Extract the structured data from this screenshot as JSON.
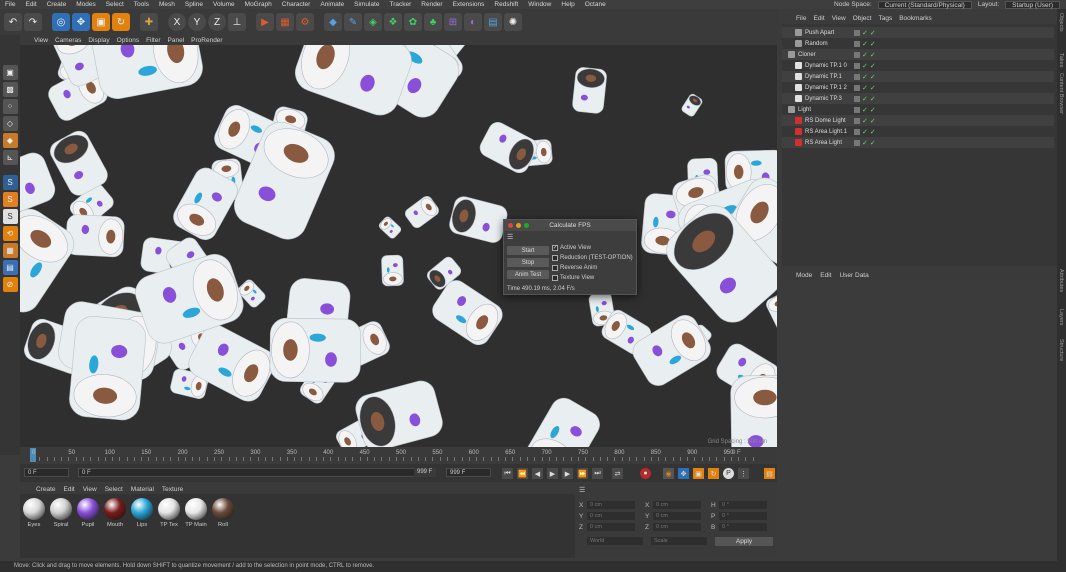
{
  "menubar": {
    "items": [
      "File",
      "Edit",
      "Create",
      "Modes",
      "Select",
      "Tools",
      "Mesh",
      "Spline",
      "Volume",
      "MoGraph",
      "Character",
      "Animate",
      "Simulate",
      "Tracker",
      "Render",
      "Extensions",
      "Redshift",
      "Window",
      "Help",
      "Octane"
    ],
    "node_space_label": "Node Space:",
    "node_space_value": "Current (Standard/Physical)",
    "layout_label": "Layout:",
    "layout_value": "Startup (User)"
  },
  "viewport": {
    "menu": [
      "View",
      "Cameras",
      "Display",
      "Options",
      "Filter",
      "Panel",
      "ProRender"
    ],
    "overlay": "Grid Spacing : 500 cm"
  },
  "fps_dialog": {
    "title": "Calculate FPS",
    "buttons": [
      "Start",
      "Stop",
      "Anim Test"
    ],
    "options": [
      {
        "label": "Active View",
        "checked": true
      },
      {
        "label": "Reduction (TEST-OPTION)",
        "checked": false
      },
      {
        "label": "Reverse Anim",
        "checked": false
      },
      {
        "label": "Texture View",
        "checked": false
      }
    ],
    "time": "Time 490.19 ms, 2.04 F/s"
  },
  "timeline": {
    "ticks": [
      "0",
      "50",
      "100",
      "150",
      "200",
      "250",
      "300",
      "350",
      "400",
      "450",
      "500",
      "550",
      "600",
      "650",
      "700",
      "750",
      "800",
      "850",
      "900",
      "950"
    ],
    "end_label": "0 F"
  },
  "transport": {
    "start_frame": "0 F",
    "current_frame": "0 F",
    "end_frame": "999 F",
    "max_frame": "999 F"
  },
  "material_manager": {
    "menu": [
      "Create",
      "Edit",
      "View",
      "Select",
      "Material",
      "Texture"
    ],
    "materials": [
      {
        "name": "Eyes",
        "color": "#d8d8d8"
      },
      {
        "name": "Spiral",
        "color": "#cfcfcf"
      },
      {
        "name": "Pupil",
        "color": "#8a4fd8"
      },
      {
        "name": "Mouth",
        "color": "#7a1a1a"
      },
      {
        "name": "Lips",
        "color": "#2aa6d8"
      },
      {
        "name": "TP Tex",
        "color": "#e4e4e4"
      },
      {
        "name": "TP Main",
        "color": "#e8e8e8"
      },
      {
        "name": "Roll",
        "color": "#6a4a3a"
      }
    ]
  },
  "coordinates": {
    "labels": [
      "X",
      "Y",
      "Z",
      "X",
      "Y",
      "Z",
      "H",
      "P",
      "B"
    ],
    "fields": [
      "0 cm",
      "0 cm",
      "0 cm",
      "0 cm",
      "0 cm",
      "0 cm",
      "0 °",
      "0 °",
      "0 °"
    ],
    "dropdown_1": "World",
    "dropdown_2": "Scale",
    "apply": "Apply"
  },
  "status": {
    "text": "Move: Click and drag to move elements. Hold down SHIFT to quantize movement / add to the selection in point mode, CTRL to remove."
  },
  "object_manager": {
    "menu": [
      "File",
      "Edit",
      "View",
      "Object",
      "Tags",
      "Bookmarks"
    ],
    "objects": [
      {
        "name": "Push Apart",
        "indent": 1,
        "icon_color": "#9a9a9a"
      },
      {
        "name": "Random",
        "indent": 1,
        "icon_color": "#9a9a9a"
      },
      {
        "name": "Cloner",
        "indent": 0,
        "icon_color": "#9a9a9a"
      },
      {
        "name": "Dynamic TP.1 0",
        "indent": 1,
        "icon_color": "#e0e0e0"
      },
      {
        "name": "Dynamic TP.1",
        "indent": 1,
        "icon_color": "#e0e0e0"
      },
      {
        "name": "Dynamic TP.1 2",
        "indent": 1,
        "icon_color": "#e0e0e0"
      },
      {
        "name": "Dynamic TP.3",
        "indent": 1,
        "icon_color": "#e0e0e0"
      },
      {
        "name": "Light",
        "indent": 0,
        "icon_color": "#9a9a9a"
      },
      {
        "name": "RS Dome Light",
        "indent": 1,
        "icon_color": "#d23030"
      },
      {
        "name": "RS Area Light.1",
        "indent": 1,
        "icon_color": "#d23030"
      },
      {
        "name": "RS Area Light",
        "indent": 1,
        "icon_color": "#d23030"
      }
    ]
  },
  "attributes": {
    "menu": [
      "Mode",
      "Edit",
      "User Data"
    ]
  },
  "right_tabs": [
    "Objects",
    "Takes",
    "Content Browser",
    "Attributes",
    "Layers",
    "Structure"
  ]
}
